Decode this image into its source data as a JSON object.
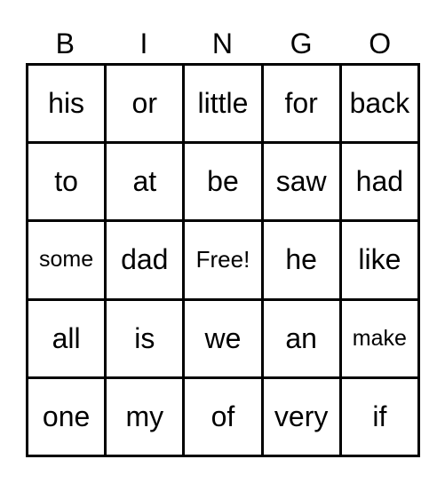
{
  "header": [
    "B",
    "I",
    "N",
    "G",
    "O"
  ],
  "rows": [
    [
      "his",
      "or",
      "little",
      "for",
      "back"
    ],
    [
      "to",
      "at",
      "be",
      "saw",
      "had"
    ],
    [
      "some",
      "dad",
      "Free!",
      "he",
      "like"
    ],
    [
      "all",
      "is",
      "we",
      "an",
      "make"
    ],
    [
      "one",
      "my",
      "of",
      "very",
      "if"
    ]
  ]
}
